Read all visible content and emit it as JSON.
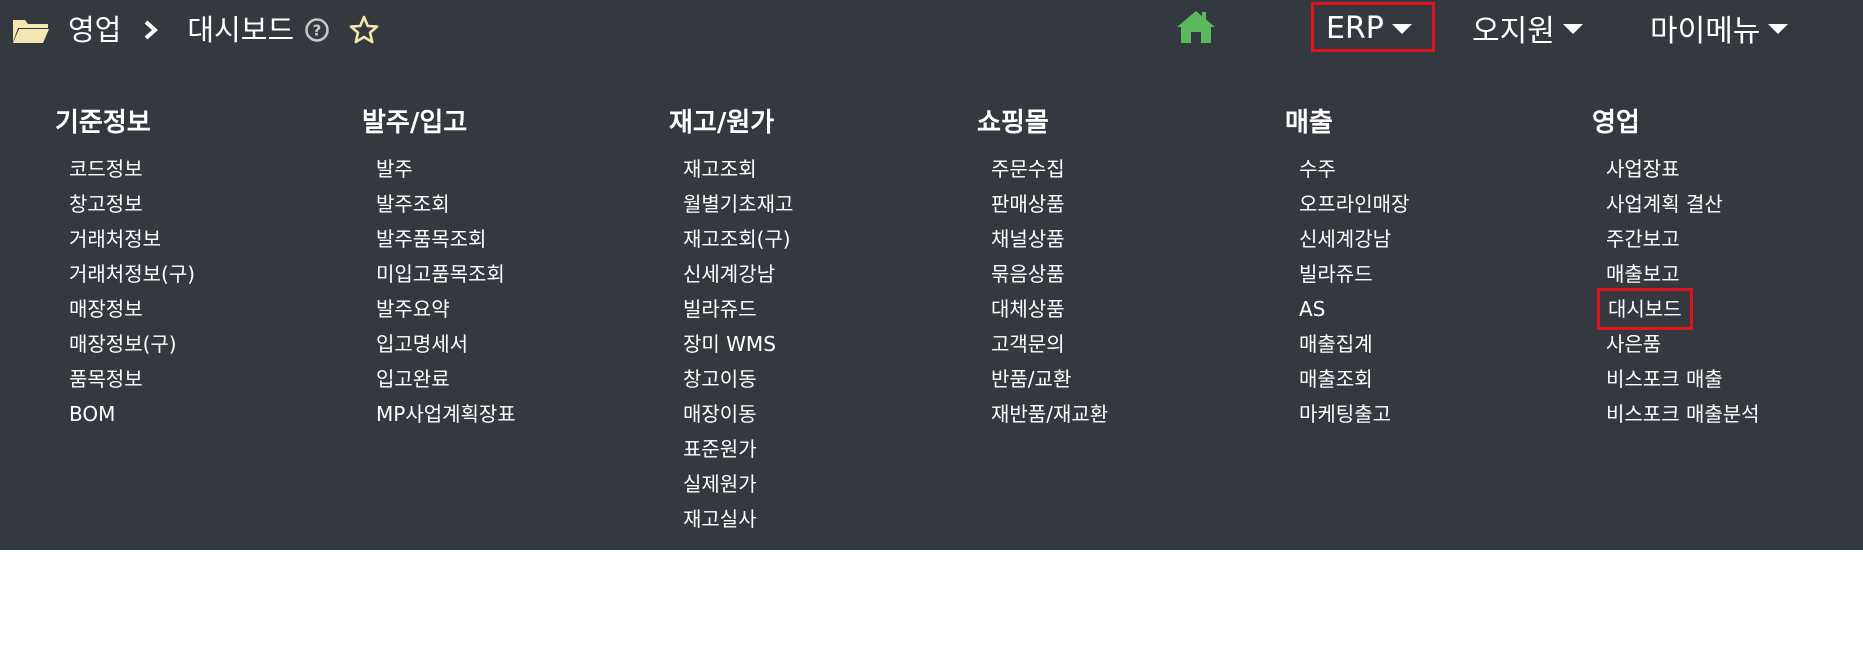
{
  "breadcrumb": {
    "section": "영업",
    "page": "대시보드"
  },
  "header": {
    "erp_label": "ERP",
    "user_label": "오지원",
    "mymenu_label": "마이메뉴"
  },
  "colors": {
    "background": "#343940",
    "home_icon": "#5cb85c",
    "highlight_border": "#e0141e",
    "star_outline": "#f2e6a8",
    "folder": "#f5e7b3"
  },
  "columns": [
    {
      "title": "기준정보",
      "items": [
        "코드정보",
        "창고정보",
        "거래처정보",
        "거래처정보(구)",
        "매장정보",
        "매장정보(구)",
        "품목정보",
        "BOM"
      ]
    },
    {
      "title": "발주/입고",
      "items": [
        "발주",
        "발주조회",
        "발주품목조회",
        "미입고품목조회",
        "발주요약",
        "입고명세서",
        "입고완료",
        "MP사업계획장표"
      ]
    },
    {
      "title": "재고/원가",
      "items": [
        "재고조회",
        "월별기초재고",
        "재고조회(구)",
        "신세계강남",
        "빌라쥬드",
        "장미 WMS",
        "창고이동",
        "매장이동",
        "표준원가",
        "실제원가",
        "재고실사"
      ]
    },
    {
      "title": "쇼핑몰",
      "items": [
        "주문수집",
        "판매상품",
        "채널상품",
        "묶음상품",
        "대체상품",
        "고객문의",
        "반품/교환",
        "재반품/재교환"
      ]
    },
    {
      "title": "매출",
      "items": [
        "수주",
        "오프라인매장",
        "신세계강남",
        "빌라쥬드",
        "AS",
        "매출집계",
        "매출조회",
        "마케팅출고"
      ]
    },
    {
      "title": "영업",
      "items": [
        "사업장표",
        "사업계획 결산",
        "주간보고",
        "매출보고",
        "대시보드",
        "사은품",
        "비스포크 매출",
        "비스포크 매출분석"
      ]
    }
  ]
}
